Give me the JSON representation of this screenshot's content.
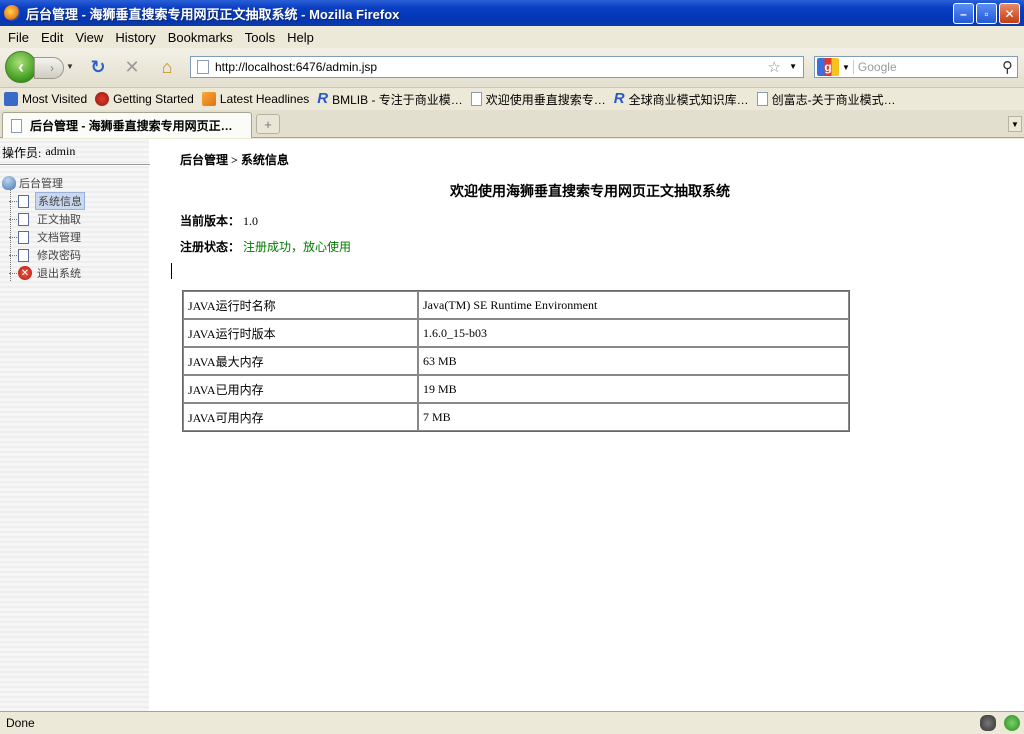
{
  "window": {
    "title": "后台管理 - 海狮垂直搜索专用网页正文抽取系统 - Mozilla Firefox",
    "minimize": "–",
    "maximize": "▫",
    "close": "✕"
  },
  "menu": [
    "File",
    "Edit",
    "View",
    "History",
    "Bookmarks",
    "Tools",
    "Help"
  ],
  "nav": {
    "back": "‹",
    "forward": "›",
    "reload": "↻",
    "stop": "✕",
    "home": "⌂",
    "url": "http://localhost:6476/admin.jsp",
    "bookmark_star": "☆",
    "search_engine": "g",
    "search_placeholder": "Google",
    "search_icon": "⚲"
  },
  "bookmarks": [
    {
      "label": "Most Visited",
      "icon": "most-visited-icon"
    },
    {
      "label": "Getting Started",
      "icon": "getting-started-icon"
    },
    {
      "label": "Latest Headlines",
      "icon": "rss-icon"
    },
    {
      "label": "BMLIB - 专注于商业模…",
      "icon": "bmlib-icon"
    },
    {
      "label": "欢迎使用垂直搜索专…",
      "icon": "page-icon"
    },
    {
      "label": "全球商业模式知识库…",
      "icon": "bmlib-icon"
    },
    {
      "label": "创富志-关于商业模式…",
      "icon": "page-icon"
    }
  ],
  "tab": {
    "title": "后台管理 - 海狮垂直搜索专用网页正…",
    "new_tab": "+"
  },
  "sidebar": {
    "operator_label": "操作员:",
    "operator_name": "admin",
    "tree_root": "后台管理",
    "items": [
      {
        "label": "系统信息",
        "selected": true
      },
      {
        "label": "正文抽取",
        "selected": false
      },
      {
        "label": "文档管理",
        "selected": false
      },
      {
        "label": "修改密码",
        "selected": false
      },
      {
        "label": "退出系统",
        "selected": false
      }
    ]
  },
  "main": {
    "breadcrumb": "后台管理 > 系统信息",
    "welcome": "欢迎使用海狮垂直搜索专用网页正文抽取系统",
    "version_label": "当前版本：",
    "version_value": "1.0",
    "reg_label": "注册状态：",
    "reg_value": "注册成功，放心使用",
    "reg_color": "#007a00",
    "table": [
      [
        "JAVA运行时名称",
        "Java(TM) SE Runtime Environment"
      ],
      [
        "JAVA运行时版本",
        "1.6.0_15-b03"
      ],
      [
        "JAVA最大内存",
        "63 MB"
      ],
      [
        "JAVA已用内存",
        "19 MB"
      ],
      [
        "JAVA可用内存",
        "7 MB"
      ]
    ]
  },
  "status": {
    "text": "Done"
  }
}
